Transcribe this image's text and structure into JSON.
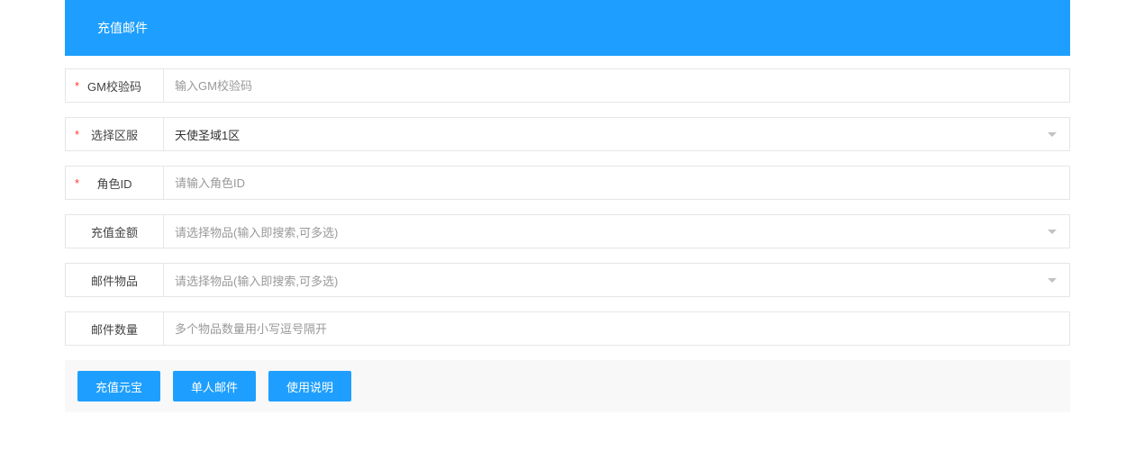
{
  "header": {
    "title": "充值邮件"
  },
  "fields": {
    "gm_code": {
      "label": "GM校验码",
      "placeholder": "输入GM校验码",
      "value": ""
    },
    "server": {
      "label": "选择区服",
      "selected": "天使圣域1区"
    },
    "role_id": {
      "label": "角色ID",
      "placeholder": "请输入角色ID",
      "value": ""
    },
    "recharge_amount": {
      "label": "充值金额",
      "placeholder": "请选择物品(输入即搜索,可多选)"
    },
    "mail_items": {
      "label": "邮件物品",
      "placeholder": "请选择物品(输入即搜索,可多选)"
    },
    "mail_quantity": {
      "label": "邮件数量",
      "placeholder": "多个物品数量用小写逗号隔开",
      "value": ""
    }
  },
  "buttons": {
    "recharge": "充值元宝",
    "single_mail": "单人邮件",
    "instructions": "使用说明"
  },
  "colors": {
    "primary": "#1e9fff",
    "border": "#e6e6e6",
    "placeholder": "#999",
    "required": "#ff3b30"
  }
}
